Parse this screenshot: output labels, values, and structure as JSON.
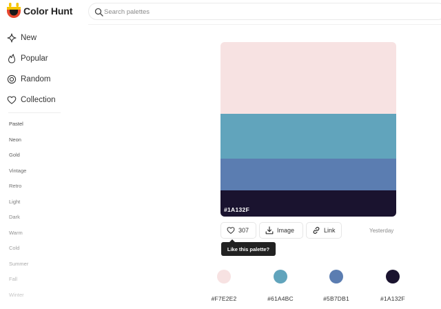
{
  "app": {
    "brand": "Color Hunt"
  },
  "search": {
    "placeholder": "Search palettes",
    "value": ""
  },
  "nav": [
    {
      "label": "New",
      "icon": "sparkle-icon"
    },
    {
      "label": "Popular",
      "icon": "flame-icon"
    },
    {
      "label": "Random",
      "icon": "spiral-icon"
    },
    {
      "label": "Collection",
      "icon": "heart-icon"
    }
  ],
  "tags": [
    {
      "label": "Pastel",
      "color": "#4a4a4a"
    },
    {
      "label": "Neon",
      "color": "#555555"
    },
    {
      "label": "Gold",
      "color": "#5e5e5e"
    },
    {
      "label": "Vintage",
      "color": "#686868"
    },
    {
      "label": "Retro",
      "color": "#727272"
    },
    {
      "label": "Light",
      "color": "#7c7c7c"
    },
    {
      "label": "Dark",
      "color": "#878787"
    },
    {
      "label": "Warm",
      "color": "#929292"
    },
    {
      "label": "Cold",
      "color": "#9e9e9e"
    },
    {
      "label": "Summer",
      "color": "#aaaaaa"
    },
    {
      "label": "Fall",
      "color": "#b8b8b8"
    },
    {
      "label": "Winter",
      "color": "#c6c6c6"
    }
  ],
  "palette": {
    "colors": [
      "#F7E2E2",
      "#61A4BC",
      "#5B7DB1",
      "#1A132F"
    ],
    "hovered_hex": "#1A132F",
    "likes": "307",
    "image_label": "Image",
    "link_label": "Link",
    "date": "Yesterday",
    "tooltip": "Like this palette?"
  }
}
